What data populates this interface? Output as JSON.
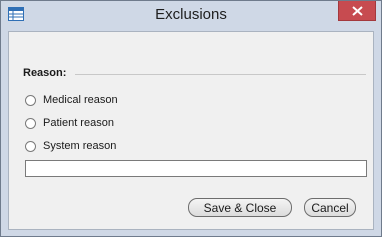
{
  "window": {
    "title": "Exclusions",
    "app_icon": "table-window-icon",
    "close_icon": "close-icon"
  },
  "reason_group": {
    "label": "Reason:",
    "options": [
      {
        "label": "Medical reason",
        "selected": false
      },
      {
        "label": "Patient reason",
        "selected": false
      },
      {
        "label": "System reason",
        "selected": false
      }
    ]
  },
  "reason_input": {
    "value": "",
    "placeholder": ""
  },
  "buttons": {
    "save_label": "Save & Close",
    "cancel_label": "Cancel"
  },
  "colors": {
    "frame": "#cfd8e6",
    "close": "#c74b50",
    "client": "#f0f0f0"
  }
}
